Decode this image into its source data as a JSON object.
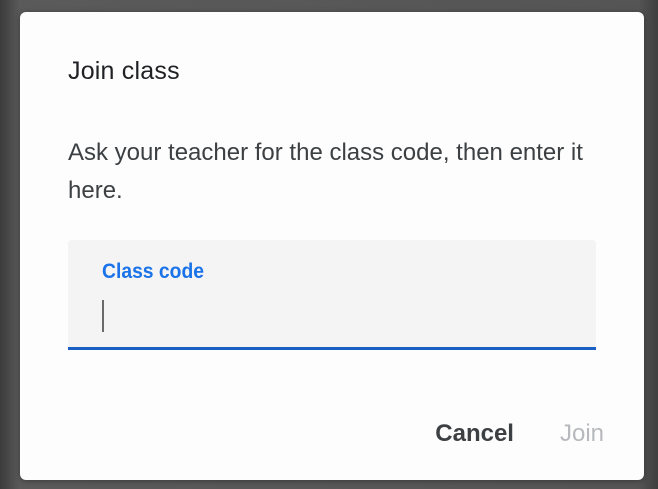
{
  "dialog": {
    "title": "Join class",
    "description": "Ask your teacher for the class code, then enter it here.",
    "field": {
      "label": "Class code",
      "value": ""
    },
    "actions": {
      "cancel_label": "Cancel",
      "join_label": "Join"
    }
  },
  "colors": {
    "accent": "#1a73e8",
    "underline": "#1a5fc4",
    "disabled_text": "#b7b9bc"
  }
}
